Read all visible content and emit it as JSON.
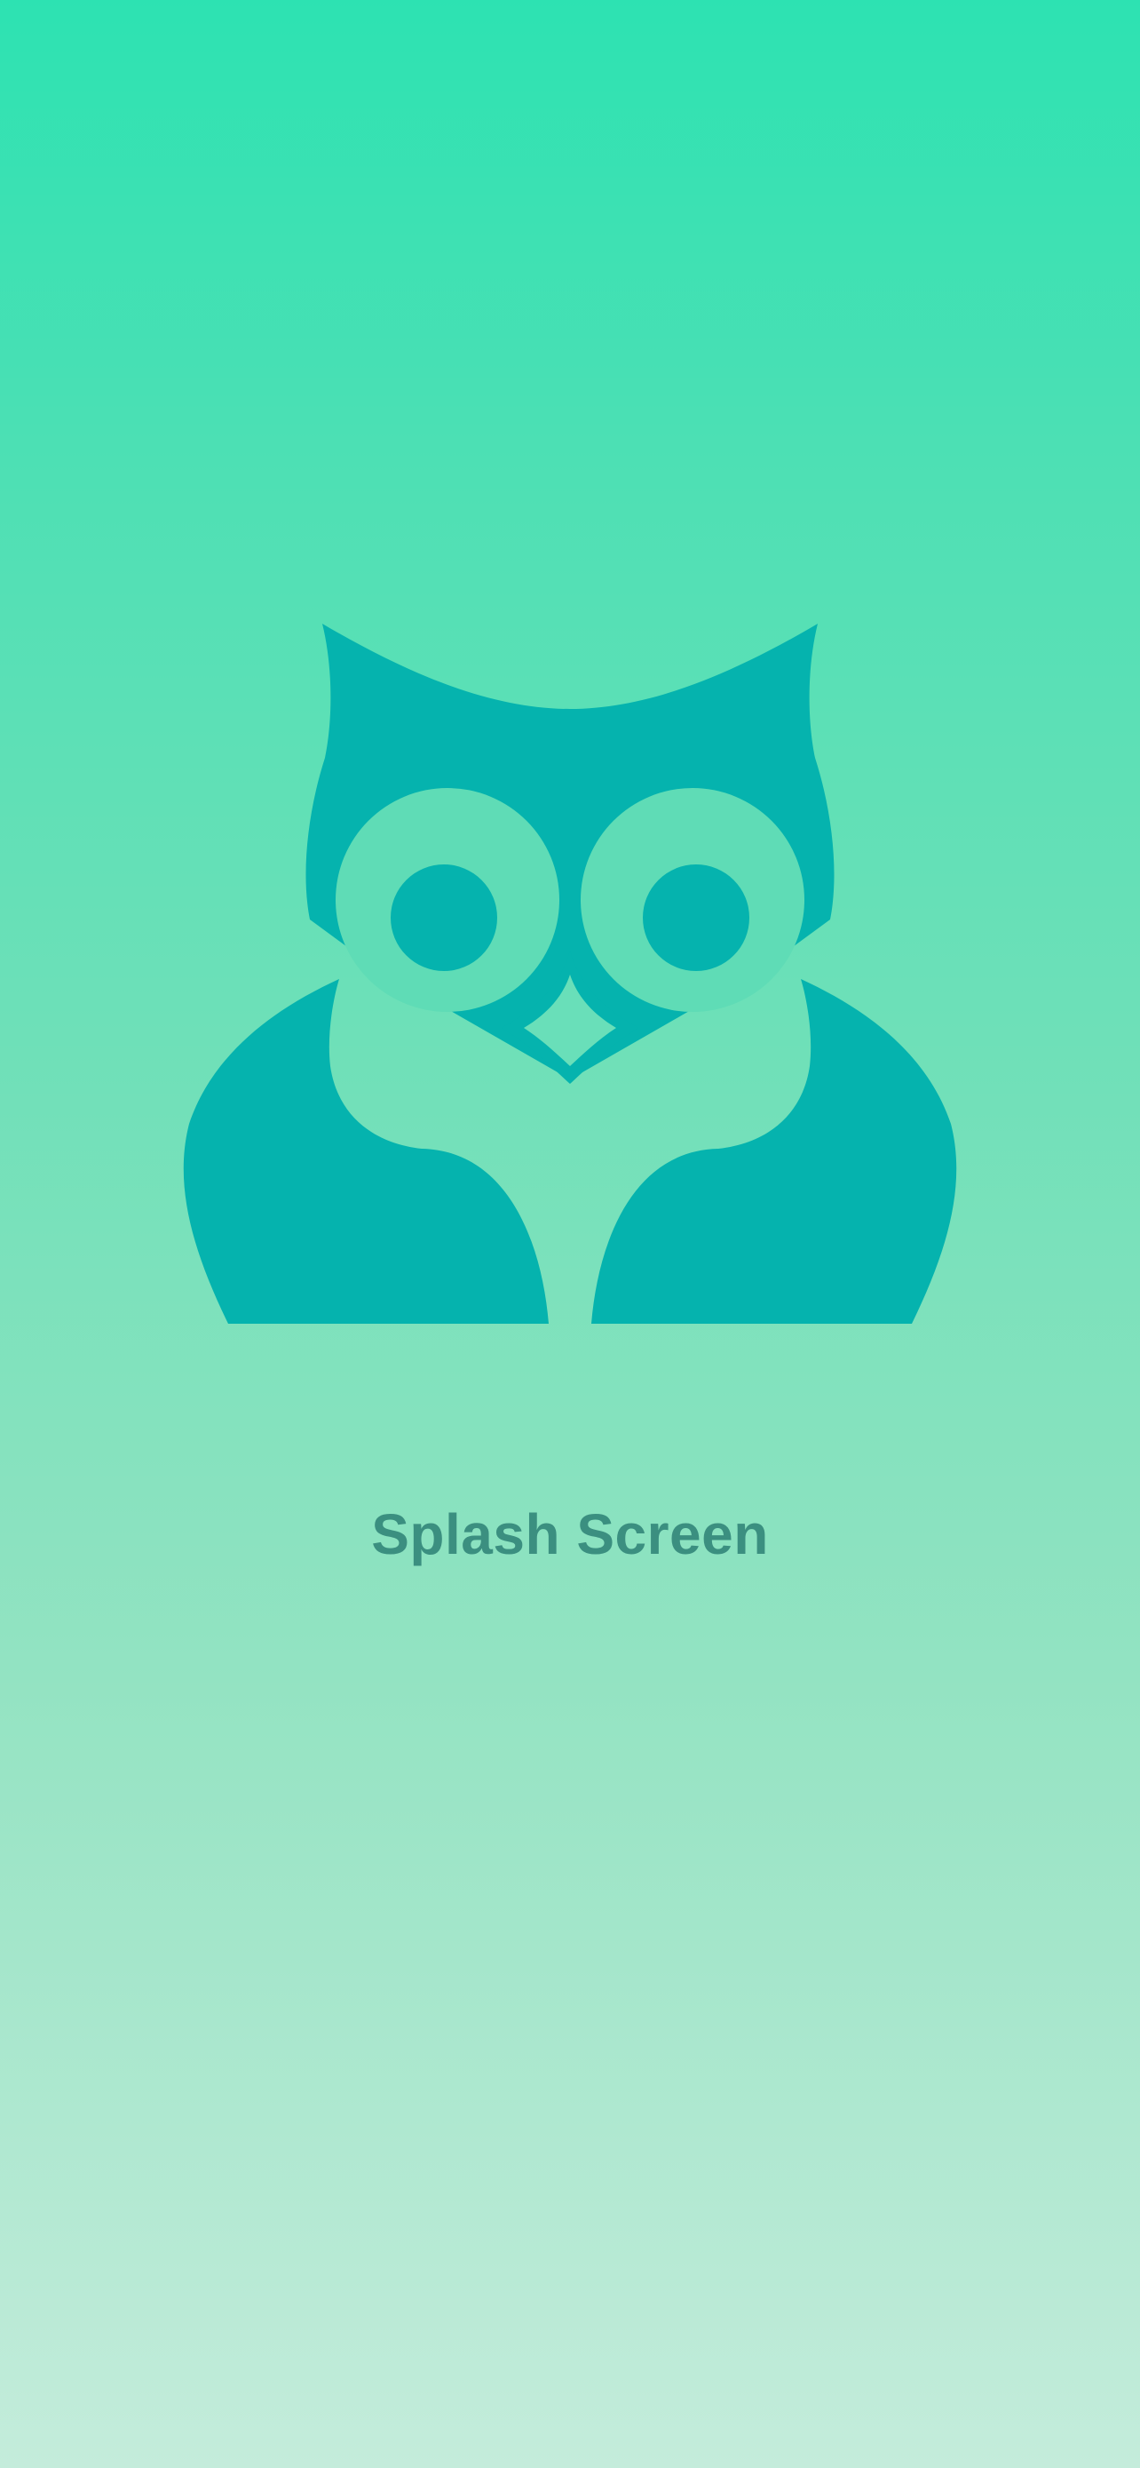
{
  "splash": {
    "title": "Splash Screen",
    "logo_icon": "owl-icon",
    "colors": {
      "background_top": "#2de2b2",
      "background_bottom": "#c4ecdb",
      "logo": "#05b3ae",
      "title_text": "#3b8f80"
    }
  }
}
